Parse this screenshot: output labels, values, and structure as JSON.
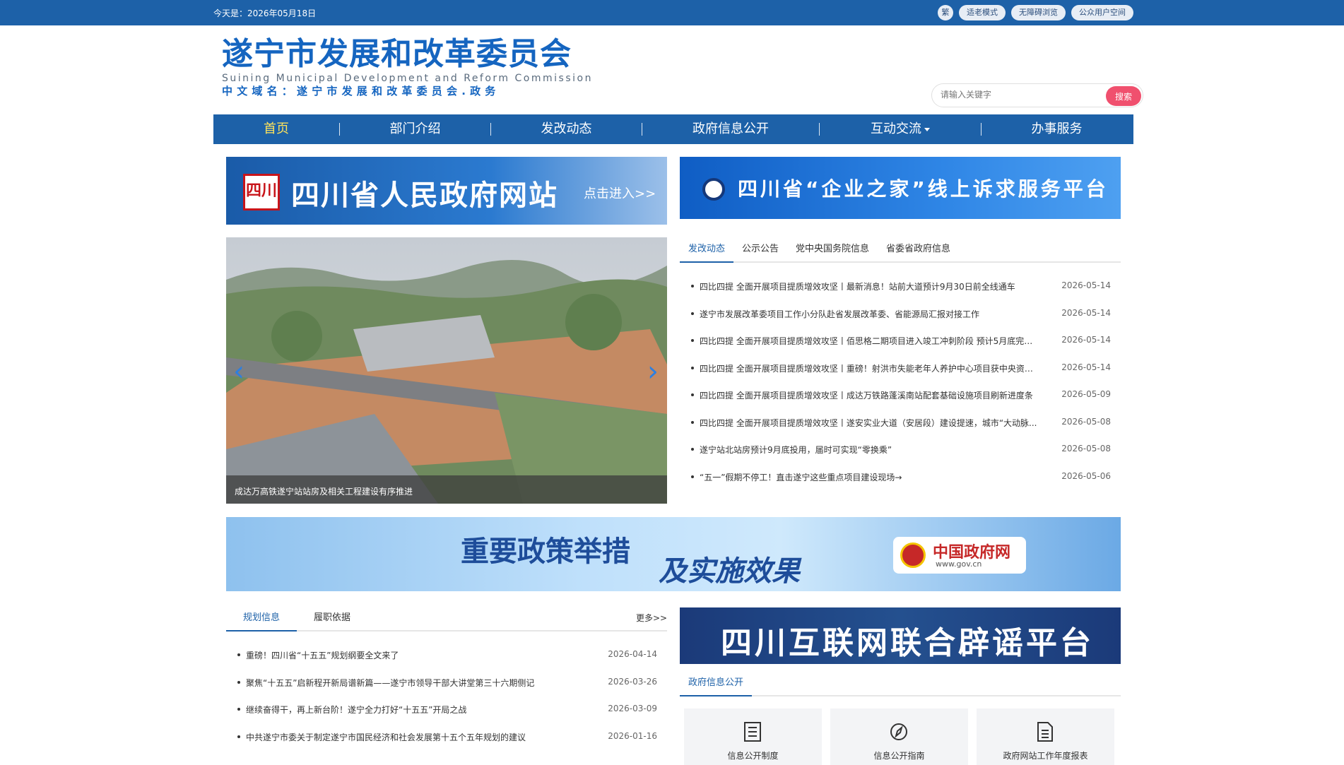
{
  "topbar": {
    "date": "今天是：2026年05月18日",
    "buttons": [
      "繁",
      "适老模式",
      "无障碍浏览",
      "公众用户空间"
    ]
  },
  "header": {
    "logo_cn": "遂宁市发展和改革委员会",
    "logo_en": "Suining Municipal Development and Reform Commission",
    "domain": "中文域名：遂宁市发展和改革委员会.政务",
    "search_placeholder": "请输入关键字",
    "search_button": "搜索"
  },
  "nav": {
    "items": [
      "首页",
      "部门介绍",
      "发改动态",
      "政府信息公开",
      "互动交流",
      "办事服务"
    ],
    "active": "首页"
  },
  "banners": {
    "b1_seal": "四川",
    "b1_title": "四川省人民政府网站",
    "b1_enter": "点击进入>>",
    "b2_title": "四川省“企业之家”线上诉求服务平台",
    "b3_title1": "重要政策举措",
    "b3_title2": "及实施效果",
    "b3_gov_name": "中国政府网",
    "b3_gov_url": "www.gov.cn",
    "b4_title": "四川互联网联合辟谣平台"
  },
  "slider": {
    "caption": "成达万高铁遂宁站站房及相关工程建设有序推进",
    "prev_icon": "‹",
    "next_icon": "›"
  },
  "news": {
    "tabs": [
      "发改动态",
      "公示公告",
      "党中央国务院信息",
      "省委省政府信息"
    ],
    "items": [
      {
        "title": "四比四提 全面开展项目提质增效攻坚丨最新消息！站前大道预计9月30日前全线通车",
        "date": "2026-05-14"
      },
      {
        "title": "遂宁市发展改革委项目工作小分队赴省发展改革委、省能源局汇报对接工作",
        "date": "2026-05-14"
      },
      {
        "title": "四比四提 全面开展项目提质增效攻坚丨佰思格二期项目进入竣工冲刺阶段 预计5月底完成...",
        "date": "2026-05-14"
      },
      {
        "title": "四比四提 全面开展项目提质增效攻坚丨重磅！射洪市失能老年人养护中心项目获中央资金...",
        "date": "2026-05-14"
      },
      {
        "title": "四比四提 全面开展项目提质增效攻坚丨成达万铁路蓬溪南站配套基础设施项目刷新进度条",
        "date": "2026-05-09"
      },
      {
        "title": "四比四提 全面开展项目提质增效攻坚丨遂安实业大道（安居段）建设提速，城市“大动脉...",
        "date": "2026-05-08"
      },
      {
        "title": "遂宁站北站房预计9月底投用，届时可实现“零换乘”",
        "date": "2026-05-08"
      },
      {
        "title": "“五一”假期不停工！直击遂宁这些重点项目建设现场→",
        "date": "2026-05-06"
      }
    ]
  },
  "plan": {
    "tabs": [
      "规划信息",
      "履职依据"
    ],
    "more": "更多>>",
    "items": [
      {
        "title": "重磅！四川省“十五五”规划纲要全文来了",
        "date": "2026-04-14"
      },
      {
        "title": "聚焦“十五五”启新程开新局谱新篇——遂宁市领导干部大讲堂第三十六期侧记",
        "date": "2026-03-26"
      },
      {
        "title": "继续奋得干，再上新台阶！遂宁全力打好“十五五”开局之战",
        "date": "2026-03-09"
      },
      {
        "title": "中共遂宁市委关于制定遂宁市国民经济和社会发展第十五个五年规划的建议",
        "date": "2026-01-16"
      }
    ]
  },
  "info": {
    "tabs": [
      "政府信息公开"
    ],
    "cards": [
      {
        "label": "信息公开制度",
        "icon": "document-icon"
      },
      {
        "label": "信息公开指南",
        "icon": "compass-icon"
      },
      {
        "label": "政府网站工作年度报表",
        "icon": "report-icon"
      }
    ]
  }
}
